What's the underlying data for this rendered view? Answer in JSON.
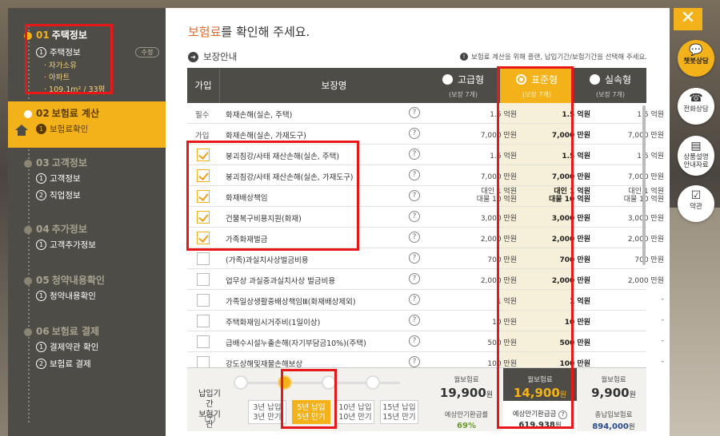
{
  "sidebar": {
    "steps": [
      {
        "num": "01",
        "title": "주택정보",
        "subs": [
          {
            "n": "1",
            "label": "주택정보"
          }
        ],
        "info": [
          "· 자가소유",
          "· 아파트",
          "· 109.1m² / 33평"
        ],
        "edit": "수정"
      },
      {
        "num": "02",
        "title": "보험료 계산",
        "subs": [
          {
            "n": "1",
            "label": "보험료확인"
          }
        ]
      },
      {
        "num": "03",
        "title": "고객정보",
        "subs": [
          {
            "n": "1",
            "label": "고객정보"
          },
          {
            "n": "2",
            "label": "직업정보"
          }
        ]
      },
      {
        "num": "04",
        "title": "추가정보",
        "subs": [
          {
            "n": "1",
            "label": "고객추가정보"
          }
        ]
      },
      {
        "num": "05",
        "title": "청약내용확인",
        "subs": [
          {
            "n": "1",
            "label": "청약내용확인"
          }
        ]
      },
      {
        "num": "06",
        "title": "보험료 결제",
        "subs": [
          {
            "n": "1",
            "label": "결제약관 확인"
          },
          {
            "n": "2",
            "label": "보험료 결제"
          }
        ]
      }
    ]
  },
  "main": {
    "heading_hl": "보험료",
    "heading_rest": "를 확인해 주세요.",
    "guide": "보장안내",
    "notice": "보험료 계산을 위해 플랜, 납입기간/보험기간을 선택해 주세요.",
    "col_join": "가입",
    "col_name": "보장명",
    "plans": [
      {
        "name": "고급형",
        "sub": "(보장 7개)",
        "selected": false
      },
      {
        "name": "표준형",
        "sub": "(보장 7개)",
        "selected": true
      },
      {
        "name": "실속형",
        "sub": "(보장 7개)",
        "selected": false
      }
    ],
    "rows": [
      {
        "tag": "필수",
        "checked": null,
        "name": "화재손해(실손, 주택)",
        "vals": [
          "1.5 억원",
          "1.5 억원",
          "1.5 억원"
        ]
      },
      {
        "tag": "가입",
        "checked": null,
        "name": "화재손해(실손, 가재도구)",
        "vals": [
          "7,000 만원",
          "7,000 만원",
          "7,000 만원"
        ]
      },
      {
        "tag": "",
        "checked": true,
        "name": "붕괴침강/사태 재산손해(실손, 주택)",
        "vals": [
          "1.5 억원",
          "1.5 억원",
          "1.5 억원"
        ]
      },
      {
        "tag": "",
        "checked": true,
        "name": "붕괴침강/사태 재산손해(실손, 가재도구)",
        "vals": [
          "7,000 만원",
          "7,000 만원",
          "7,000 만원"
        ]
      },
      {
        "tag": "",
        "checked": true,
        "name": "화재배상책임",
        "vals": [
          "대인 1 억원\n대물 10 억원",
          "대인 1 억원\n대물 10 억원",
          "대인 1 억원\n대물 10 억원"
        ]
      },
      {
        "tag": "",
        "checked": true,
        "name": "건물복구비용지원(화재)",
        "vals": [
          "3,000 만원",
          "3,000 만원",
          "3,000 만원"
        ]
      },
      {
        "tag": "",
        "checked": true,
        "name": "가족화재벌금",
        "vals": [
          "2,000 만원",
          "2,000 만원",
          "2,000 만원"
        ]
      },
      {
        "tag": "",
        "checked": false,
        "name": "(가족)과실치사상벌금비용",
        "vals": [
          "700 만원",
          "700 만원",
          "700 만원"
        ]
      },
      {
        "tag": "",
        "checked": false,
        "name": "업무상 과실중과실치사상 벌금비용",
        "vals": [
          "2,000 만원",
          "2,000 만원",
          "2,000 만원"
        ]
      },
      {
        "tag": "",
        "checked": false,
        "name": "가족일상생활중배상책임Ⅲ(화재배상제외)",
        "vals": [
          "1 억원",
          "1 억원",
          "-"
        ]
      },
      {
        "tag": "",
        "checked": false,
        "name": "주택화재임시거주비(1일이상)",
        "vals": [
          "10 만원",
          "10 만원",
          "-"
        ]
      },
      {
        "tag": "",
        "checked": false,
        "name": "급배수시설누출손해(자기부담금10%)(주택)",
        "vals": [
          "500 만원",
          "500 만원",
          "-"
        ]
      },
      {
        "tag": "",
        "checked": false,
        "name": "강도상해및재물손해보상",
        "vals": [
          "100 만원",
          "100 만원",
          "-"
        ]
      }
    ],
    "footer": {
      "period_label": "납입기간\n보험기간",
      "options": [
        {
          "label": "3년 납입\n3년 만기",
          "selected": false
        },
        {
          "label": "5년 납입\n5년 만기",
          "selected": true
        },
        {
          "label": "10년 납입\n10년 만기",
          "selected": false
        },
        {
          "label": "15년 납입\n15년 만기",
          "selected": false
        }
      ],
      "monthly_label": "월보험료",
      "won": "원",
      "premiums": [
        {
          "amount": "19,900",
          "sub_label": "예상만기환급률",
          "sub_value": "69%"
        },
        {
          "amount": "14,900",
          "sub_label": "예상만기환급금",
          "sub_value": "619,938",
          "sub_unit": "원"
        },
        {
          "amount": "9,900",
          "sub_label": "총납입보험료",
          "sub_value": "894,000",
          "sub_unit": "원"
        }
      ]
    }
  },
  "rail": {
    "close": "✕",
    "buttons": [
      {
        "icon": "💬",
        "label": "챗봇상담"
      },
      {
        "icon": "☎",
        "label": "전화상담"
      },
      {
        "icon": "▤",
        "label": "상품설명\n안내자료"
      },
      {
        "icon": "☑",
        "label": "약관"
      }
    ]
  },
  "colors": {
    "accent": "#f3b21a",
    "sidebar": "#4e4c46",
    "highlight": "#e8171a"
  }
}
